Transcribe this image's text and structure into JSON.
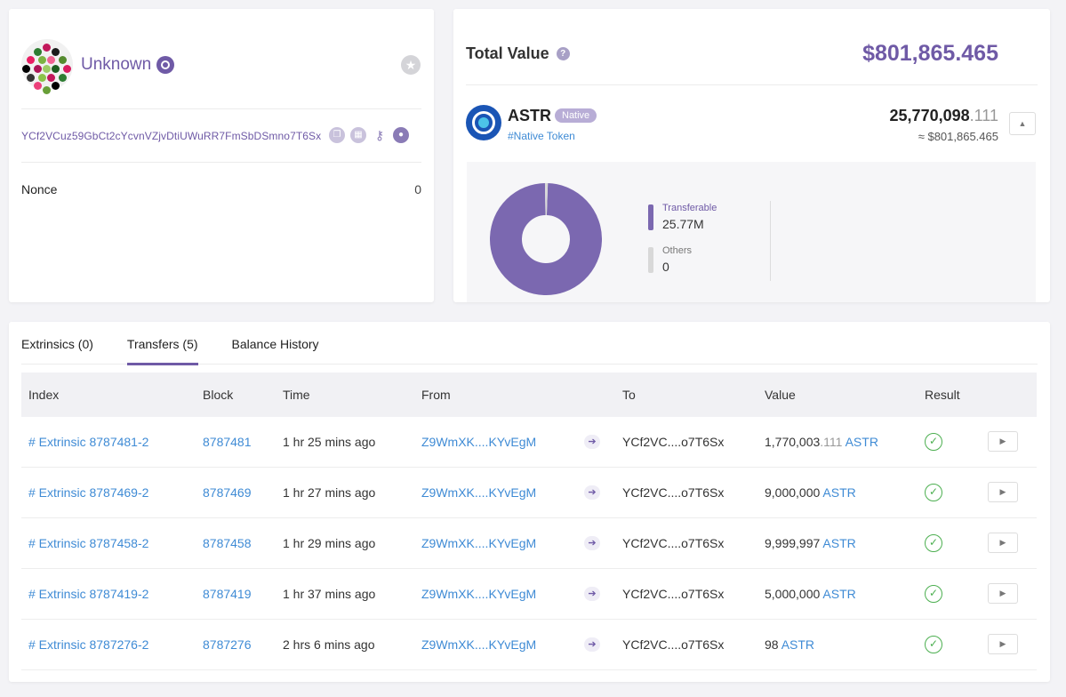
{
  "account": {
    "name": "Unknown",
    "address": "YCf2VCuz59GbCt2cYcvnVZjvDtiUWuRR7FmSbDSmno7T6Sx",
    "nonce_label": "Nonce",
    "nonce_value": "0"
  },
  "value_card": {
    "total_label": "Total Value",
    "total_amount": "$801,865.465",
    "token": {
      "symbol": "ASTR",
      "badge": "Native",
      "link": "#Native Token",
      "balance_int": "25,770,098",
      "balance_dec": ".111",
      "balance_usd": "≈ $801,865.465"
    },
    "breakdown": {
      "items": [
        {
          "label": "Transferable",
          "value": "25.77M",
          "color": "#7b68b0",
          "share": 0.99
        },
        {
          "label": "Others",
          "value": "0",
          "color": "#d8d8d8",
          "share": 0.01
        }
      ]
    }
  },
  "tabs": [
    {
      "label": "Extrinsics (0)",
      "active": false
    },
    {
      "label": "Transfers (5)",
      "active": true
    },
    {
      "label": "Balance History",
      "active": false
    }
  ],
  "table": {
    "headers": [
      "Index",
      "Block",
      "Time",
      "From",
      "To",
      "Value",
      "Result"
    ],
    "rows": [
      {
        "index": "# Extrinsic 8787481-2",
        "block": "8787481",
        "time": "1 hr 25 mins ago",
        "from": "Z9WmXK....KYvEgM",
        "to": "YCf2VC....o7T6Sx",
        "value_int": "1,770,003",
        "value_dec": ".111",
        "unit": "ASTR"
      },
      {
        "index": "# Extrinsic 8787469-2",
        "block": "8787469",
        "time": "1 hr 27 mins ago",
        "from": "Z9WmXK....KYvEgM",
        "to": "YCf2VC....o7T6Sx",
        "value_int": "9,000,000",
        "value_dec": "",
        "unit": "ASTR"
      },
      {
        "index": "# Extrinsic 8787458-2",
        "block": "8787458",
        "time": "1 hr 29 mins ago",
        "from": "Z9WmXK....KYvEgM",
        "to": "YCf2VC....o7T6Sx",
        "value_int": "9,999,997",
        "value_dec": "",
        "unit": "ASTR"
      },
      {
        "index": "# Extrinsic 8787419-2",
        "block": "8787419",
        "time": "1 hr 37 mins ago",
        "from": "Z9WmXK....KYvEgM",
        "to": "YCf2VC....o7T6Sx",
        "value_int": "5,000,000",
        "value_dec": "",
        "unit": "ASTR"
      },
      {
        "index": "# Extrinsic 8787276-2",
        "block": "8787276",
        "time": "2 hrs 6 mins ago",
        "from": "Z9WmXK....KYvEgM",
        "to": "YCf2VC....o7T6Sx",
        "value_int": "98",
        "value_dec": "",
        "unit": "ASTR"
      }
    ]
  },
  "icons": {
    "identity": "github-icon",
    "favorite": "star-icon",
    "address_actions": [
      "copy-icon",
      "qr-code-icon",
      "key-icon",
      "user-icon"
    ],
    "direction": "arrow-right-icon",
    "result": "check-circle-icon",
    "detail": "play-triangle-icon"
  },
  "colors": {
    "accent": "#6f5aa6",
    "link": "#3f8bd5",
    "success": "#4caf50"
  }
}
